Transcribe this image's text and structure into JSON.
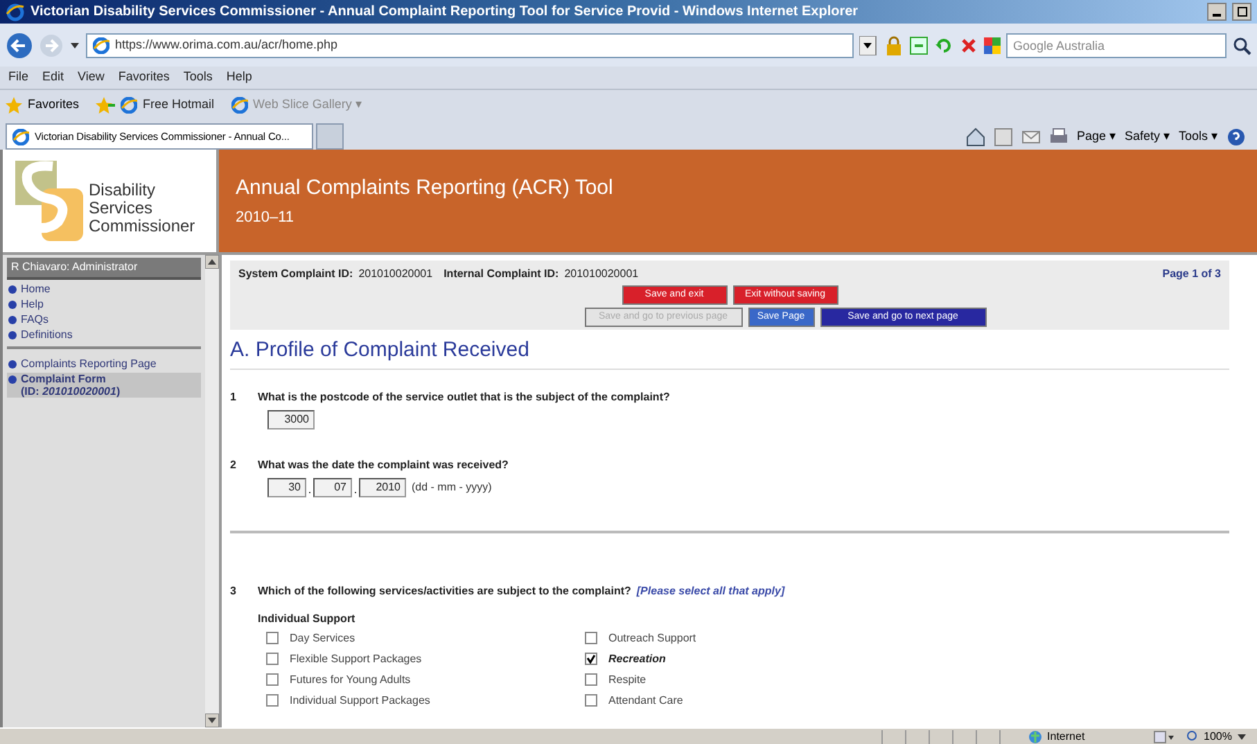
{
  "window": {
    "title": "Victorian Disability Services Commissioner - Annual Complaint Reporting Tool for Service Provid - Windows Internet Explorer"
  },
  "address_bar": {
    "url": "https://www.orima.com.au/acr/home.php",
    "search_placeholder": "Google Australia"
  },
  "menu": [
    "File",
    "Edit",
    "View",
    "Favorites",
    "Tools",
    "Help"
  ],
  "favorites_bar": {
    "favorites": "Favorites",
    "links": [
      "Free Hotmail",
      "Web Slice Gallery ▾"
    ]
  },
  "tabs": [
    {
      "label": "Victorian Disability Services Commissioner - Annual Co...",
      "selected": true
    }
  ],
  "command_bar": [
    "Page ▾",
    "Safety ▾",
    "Tools ▾"
  ],
  "logo": {
    "lines": [
      "Disability",
      "Services",
      "Commissioner"
    ]
  },
  "header": {
    "title": "Annual Complaints Reporting (ACR) Tool",
    "subtitle": "2010–11"
  },
  "sidebar": {
    "user": "R Chiavaro: Administrator",
    "items": [
      {
        "label": "Home",
        "selected": false
      },
      {
        "label": "Help",
        "selected": false
      },
      {
        "label": "FAQs",
        "selected": false
      },
      {
        "label": "Definitions",
        "selected": false
      }
    ],
    "items_2": [
      {
        "label": "Complaints Reporting Page",
        "selected": false
      },
      {
        "label": "Complaint Form\n(ID: *201010020001*)",
        "selected": true
      }
    ]
  },
  "form": {
    "system_id_label": "System Complaint ID:",
    "system_id": "201010020001",
    "internal_id_label": "Internal Complaint ID:",
    "internal_id": "201010020001",
    "page": "Page 1 of 3",
    "buttons_1": [
      {
        "label": "Save and exit",
        "kind": "red"
      },
      {
        "label": "Exit without saving",
        "kind": "red"
      }
    ],
    "buttons_2": [
      {
        "label": "Save and go to previous page",
        "kind": "disabled"
      },
      {
        "label": "Save Page",
        "kind": "blue"
      },
      {
        "label": "Save and go to next page",
        "kind": "navy"
      }
    ],
    "section": "A. Profile of Complaint Received",
    "q1": {
      "number": "1",
      "text": "What is the postcode of the service outlet that is the subject of the complaint?",
      "value": "3000"
    },
    "q2": {
      "number": "2",
      "text": "What was the date the complaint was received?",
      "day": "30",
      "month": "07",
      "year": "2010",
      "hint": "(dd - mm - yyyy)"
    },
    "q3": {
      "number": "3",
      "text": "Which of the following services/activities are subject to the complaint?",
      "note": "[Please select all that apply]",
      "group": "Individual Support",
      "options": [
        {
          "label": "Day Services",
          "checked": false
        },
        {
          "label": "Outreach Support",
          "checked": false
        },
        {
          "label": "Flexible Support Packages",
          "checked": false
        },
        {
          "label": "Recreation",
          "checked": true
        },
        {
          "label": "Futures for Young Adults",
          "checked": false
        },
        {
          "label": "Respite",
          "checked": false
        },
        {
          "label": "Individual Support Packages",
          "checked": false
        },
        {
          "label": "Attendant Care",
          "checked": false
        }
      ]
    }
  },
  "status_bar": {
    "zone": "Internet",
    "zoom": "100%"
  }
}
